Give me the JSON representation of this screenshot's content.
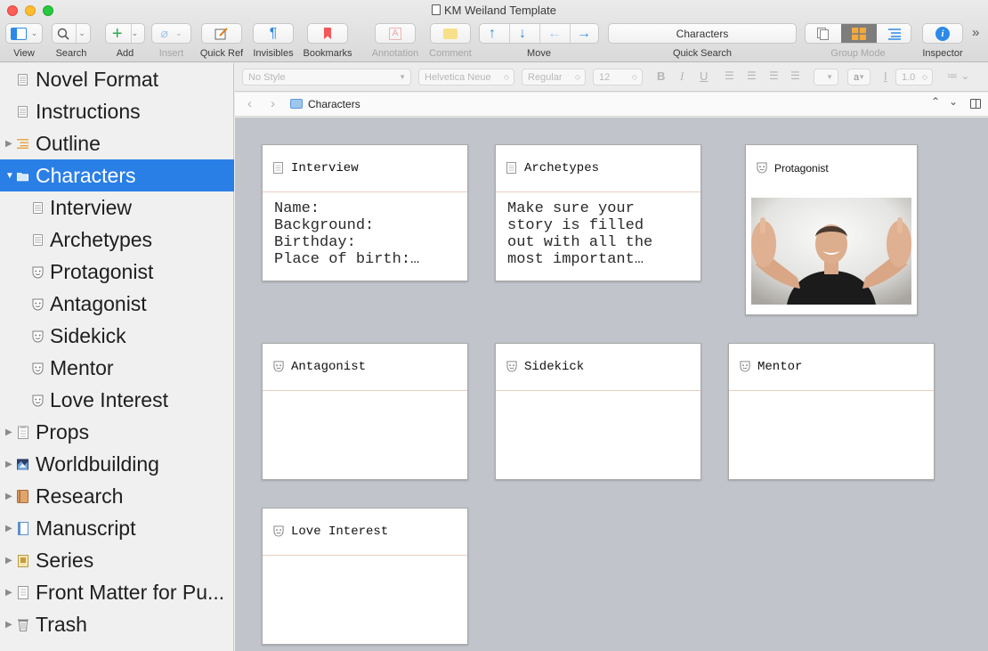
{
  "window": {
    "title": "KM Weiland Template"
  },
  "toolbar": {
    "view": "View",
    "search": "Search",
    "add": "Add",
    "insert": "Insert",
    "quick_ref": "Quick Ref",
    "invisibles": "Invisibles",
    "bookmarks": "Bookmarks",
    "annotation": "Annotation",
    "comment": "Comment",
    "move": "Move",
    "quick_search": "Quick Search",
    "quick_search_value": "Characters",
    "group_mode": "Group Mode",
    "inspector": "Inspector",
    "overflow": "»"
  },
  "formatbar": {
    "style": "No Style",
    "font": "Helvetica Neue",
    "weight": "Regular",
    "size": "12",
    "bold": "B",
    "italic": "I",
    "underline": "U",
    "text_color": "a",
    "line_spacing": "1.0"
  },
  "binder": {
    "items": [
      {
        "label": "Novel Format",
        "icon": "document-icon"
      },
      {
        "label": "Instructions",
        "icon": "document-icon"
      },
      {
        "label": "Outline",
        "icon": "outline-icon"
      },
      {
        "label": "Characters",
        "icon": "folder-icon",
        "selected": true
      },
      {
        "label": "Interview",
        "icon": "document-icon"
      },
      {
        "label": "Archetypes",
        "icon": "document-icon"
      },
      {
        "label": "Protagonist",
        "icon": "character-mask-icon"
      },
      {
        "label": "Antagonist",
        "icon": "character-mask-icon"
      },
      {
        "label": "Sidekick",
        "icon": "character-mask-icon"
      },
      {
        "label": "Mentor",
        "icon": "character-mask-icon"
      },
      {
        "label": "Love Interest",
        "icon": "character-mask-icon"
      },
      {
        "label": "Props",
        "icon": "props-icon"
      },
      {
        "label": "Worldbuilding",
        "icon": "world-icon"
      },
      {
        "label": "Research",
        "icon": "book-icon"
      },
      {
        "label": "Manuscript",
        "icon": "manuscript-icon"
      },
      {
        "label": "Series",
        "icon": "series-icon"
      },
      {
        "label": "Front Matter for Pu...",
        "icon": "front-matter-icon"
      },
      {
        "label": "Trash",
        "icon": "trash-icon"
      }
    ]
  },
  "header": {
    "title": "Characters"
  },
  "corkboard": {
    "cards": [
      {
        "title": "Interview",
        "body": "Name:\nBackground:\nBirthday:\nPlace of birth:…",
        "icon": "document-icon"
      },
      {
        "title": "Archetypes",
        "body": "Make sure your\nstory is filled\nout with all the\nmost important…",
        "icon": "document-icon"
      },
      {
        "title": "Protagonist",
        "body": "",
        "icon": "character-mask-icon",
        "image": "smiling-man-photo"
      },
      {
        "title": "Antagonist",
        "body": "",
        "icon": "character-mask-icon"
      },
      {
        "title": "Sidekick",
        "body": "",
        "icon": "character-mask-icon"
      },
      {
        "title": "Mentor",
        "body": "",
        "icon": "character-mask-icon"
      },
      {
        "title": "Love Interest",
        "body": "",
        "icon": "character-mask-icon"
      }
    ]
  },
  "colors": {
    "selection": "#2a7fe6",
    "corkboard": "#c1c5cb",
    "move_arrows": "#2d8ae8"
  }
}
